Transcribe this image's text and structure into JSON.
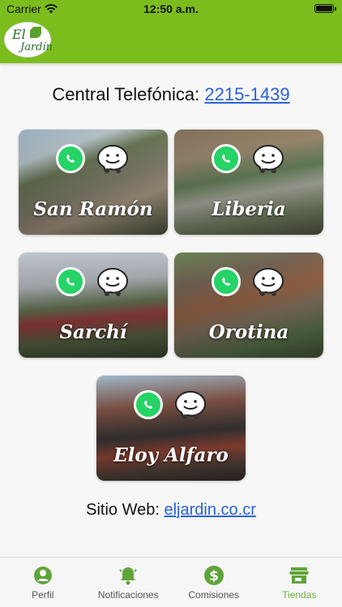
{
  "status_bar": {
    "carrier": "Carrier",
    "time": "12:50 a.m."
  },
  "header": {
    "logo_line1": "El",
    "logo_line2": "Jardín"
  },
  "phone": {
    "label": "Central Telefónica:",
    "number": "2215-1439"
  },
  "stores": [
    {
      "name": "San Ramón"
    },
    {
      "name": "Liberia"
    },
    {
      "name": "Sarchí"
    },
    {
      "name": "Orotina"
    },
    {
      "name": "Eloy Alfaro"
    }
  ],
  "website": {
    "label": "Sitio Web:",
    "url_text": "eljardin.co.cr"
  },
  "tabs": [
    {
      "label": "Perfil",
      "icon": "person-icon"
    },
    {
      "label": "Notificaciones",
      "icon": "bell-icon"
    },
    {
      "label": "Comisiones",
      "icon": "dollar-icon"
    },
    {
      "label": "Tiendas",
      "icon": "store-icon",
      "active": true
    }
  ],
  "colors": {
    "header_green": "#7cbd1e",
    "whatsapp_green": "#25d366",
    "tab_icon_green": "#5fa43a",
    "link_blue": "#2a62d6"
  }
}
